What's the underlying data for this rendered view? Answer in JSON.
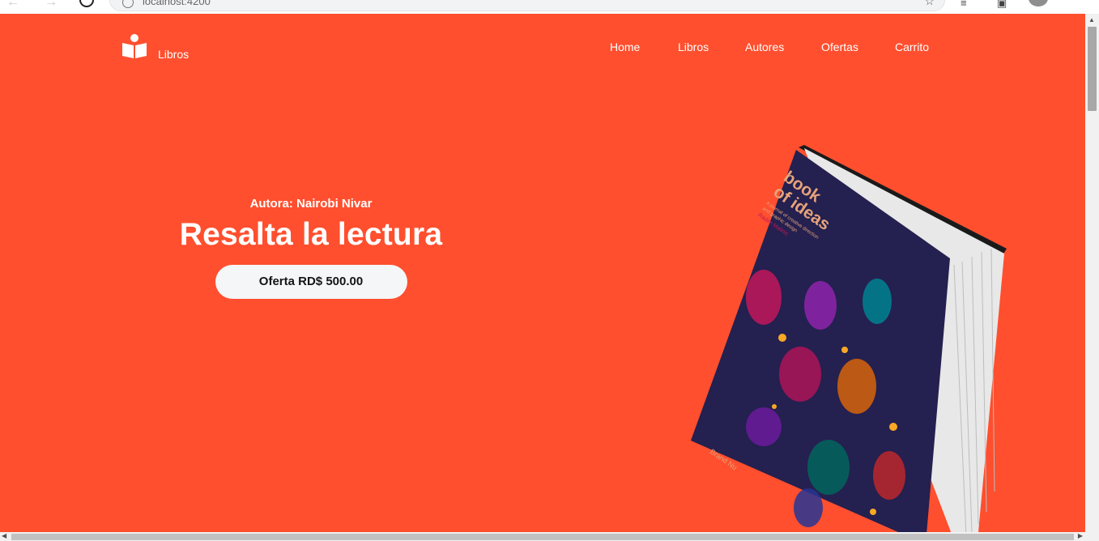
{
  "browser": {
    "url": "localhost:4200"
  },
  "brand": {
    "name": "Libros",
    "logo_icon": "open-book-reader-icon"
  },
  "nav": {
    "items": [
      {
        "label": "Home"
      },
      {
        "label": "Libros"
      },
      {
        "label": "Autores"
      },
      {
        "label": "Ofertas"
      },
      {
        "label": "Carrito"
      }
    ]
  },
  "hero": {
    "author": "Autora: Nairobi Nivar",
    "title": "Resalta la lectura",
    "offer_button": "Oferta RD$ 500.00"
  },
  "book_cover": {
    "title_line1": "book",
    "title_line2": "of ideas",
    "subtitle_line1": "A journal of creative direction",
    "subtitle_line2": "and graphic design",
    "author": "Radim Malinic",
    "publisher": "Brand Nu"
  },
  "colors": {
    "background": "#ff4f2e",
    "button_bg": "#f5f6f8",
    "book_cover": "#24204f"
  }
}
